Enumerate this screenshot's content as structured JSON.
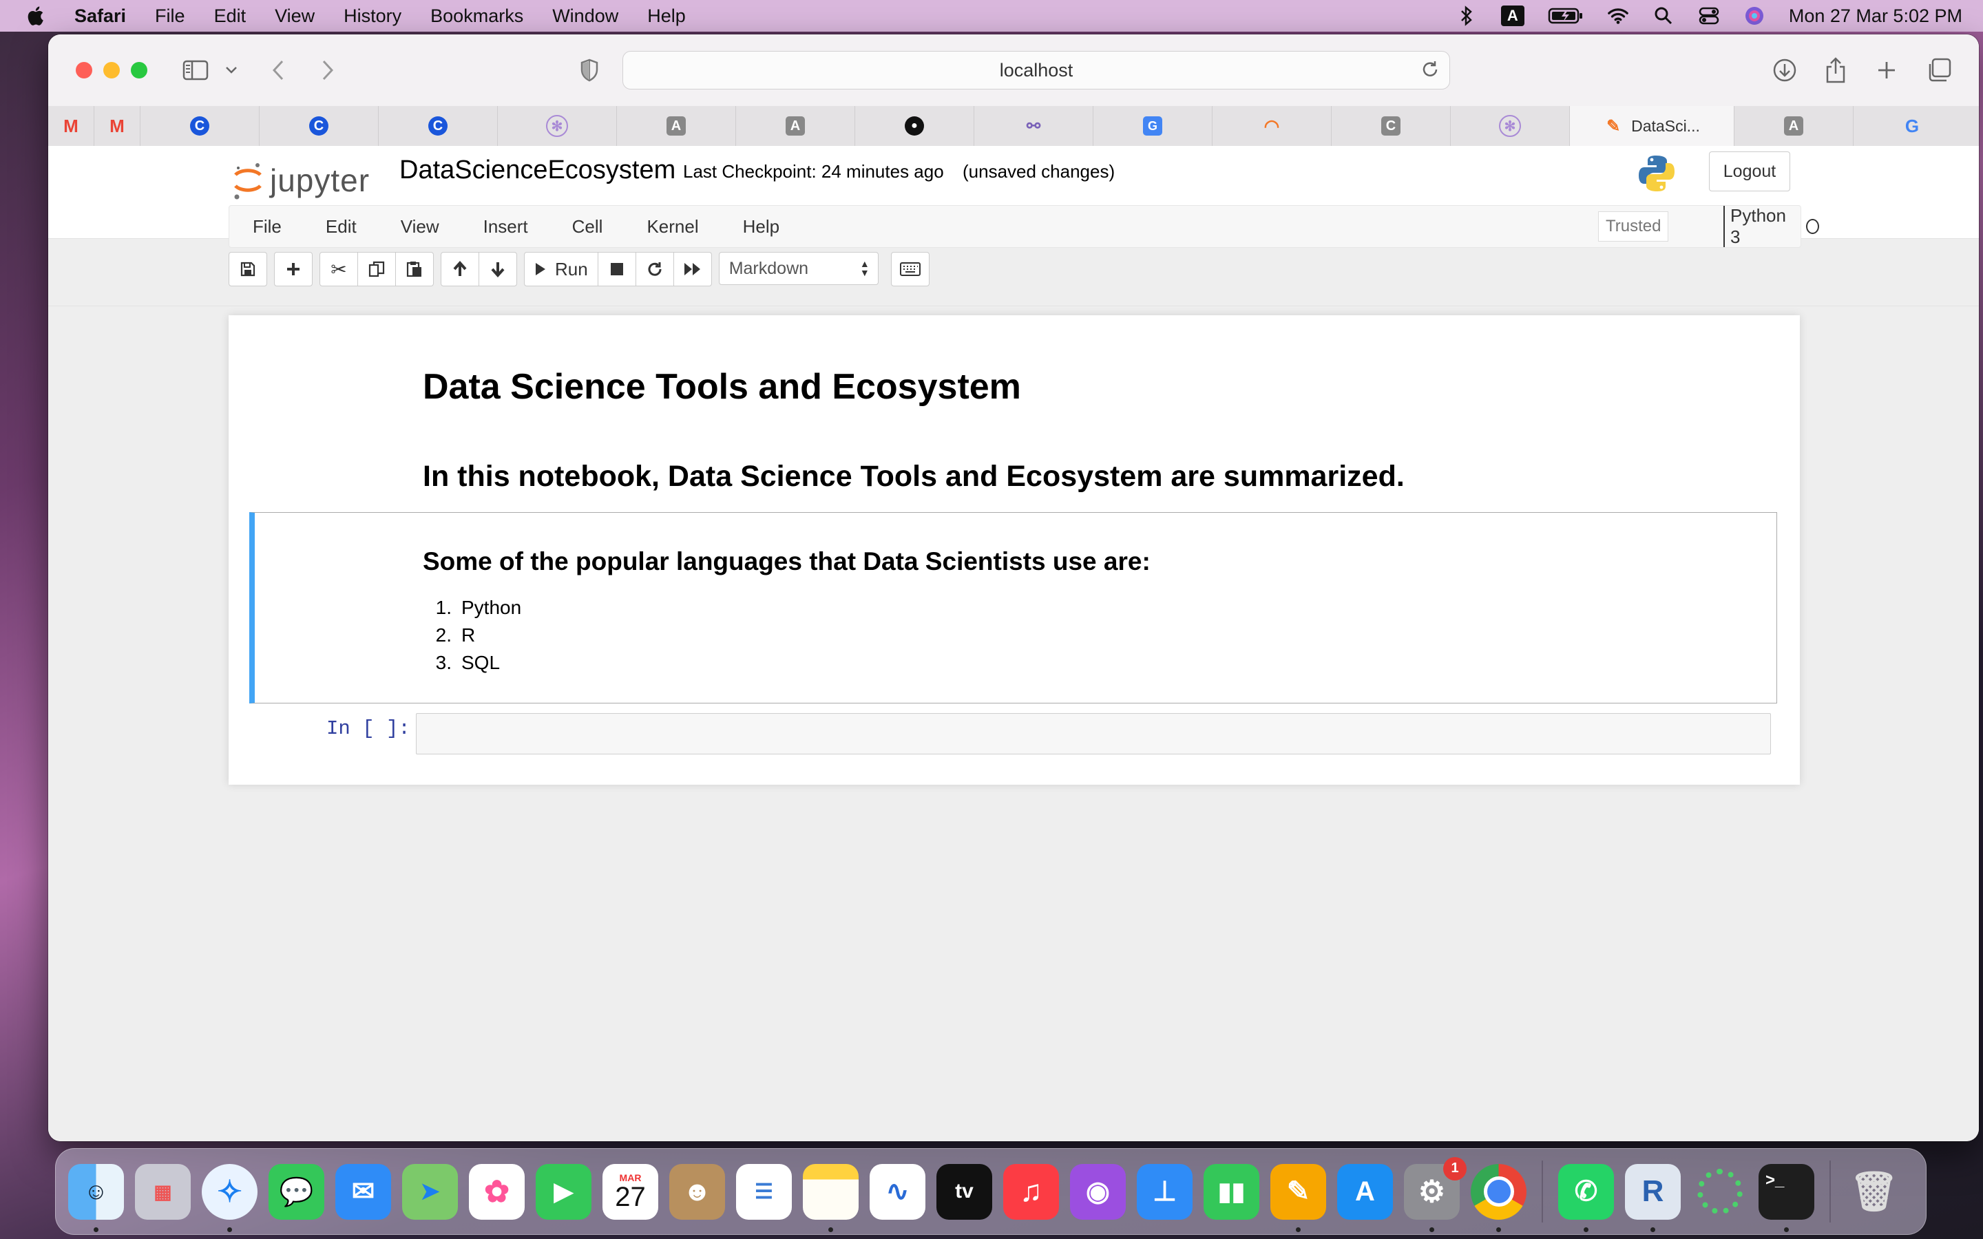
{
  "menubar": {
    "app": "Safari",
    "items": [
      "File",
      "Edit",
      "View",
      "History",
      "Bookmarks",
      "Window",
      "Help"
    ],
    "keyboard_indicator": "A",
    "clock": "Mon 27 Mar  5:02 PM"
  },
  "browser": {
    "address": "localhost",
    "tabs": [
      {
        "icon": "gmail-icon"
      },
      {
        "icon": "gmail-icon"
      },
      {
        "icon": "c-app-icon"
      },
      {
        "icon": "c-app-icon"
      },
      {
        "icon": "c-app-icon"
      },
      {
        "icon": "openai-icon"
      },
      {
        "icon": "a-app-icon"
      },
      {
        "icon": "a-app-icon"
      },
      {
        "icon": "github-icon"
      },
      {
        "icon": "link-icon"
      },
      {
        "icon": "google-translate-icon"
      },
      {
        "icon": "jupyter-icon"
      },
      {
        "icon": "c-gray-icon"
      },
      {
        "icon": "openai-icon"
      },
      {
        "icon": "notebook-icon",
        "label": "DataSci...",
        "active": true
      },
      {
        "icon": "a-app-icon"
      },
      {
        "icon": "google-icon"
      }
    ]
  },
  "jupyter": {
    "logo_text": "jupyter",
    "notebook_name": "DataScienceEcosystem",
    "checkpoint": "Last Checkpoint: 24 minutes ago",
    "save_status": "(unsaved changes)",
    "logout_label": "Logout",
    "menu": [
      "File",
      "Edit",
      "View",
      "Insert",
      "Cell",
      "Kernel",
      "Help"
    ],
    "trusted_label": "Trusted",
    "kernel_name": "Python 3",
    "run_label": "Run",
    "cell_type": "Markdown"
  },
  "notebook": {
    "title": "Data Science Tools and Ecosystem",
    "intro": "In this notebook, Data Science Tools and Ecosystem are summarized.",
    "languages_heading": "Some of the popular languages that Data Scientists use are:",
    "languages": [
      {
        "num": "1.",
        "name": "Python"
      },
      {
        "num": "2.",
        "name": "R"
      },
      {
        "num": "3.",
        "name": "SQL"
      }
    ],
    "code_prompt": "In [ ]:"
  },
  "dock": {
    "calendar_month": "MAR",
    "calendar_day": "27",
    "appletv_label": "tv",
    "settings_badge": "1"
  },
  "colors": {
    "menubar_bg": "#d9b7dc",
    "selected_cell_border": "#42a5f5",
    "prompt_color": "#303f9f",
    "jupyter_orange": "#f37726"
  }
}
